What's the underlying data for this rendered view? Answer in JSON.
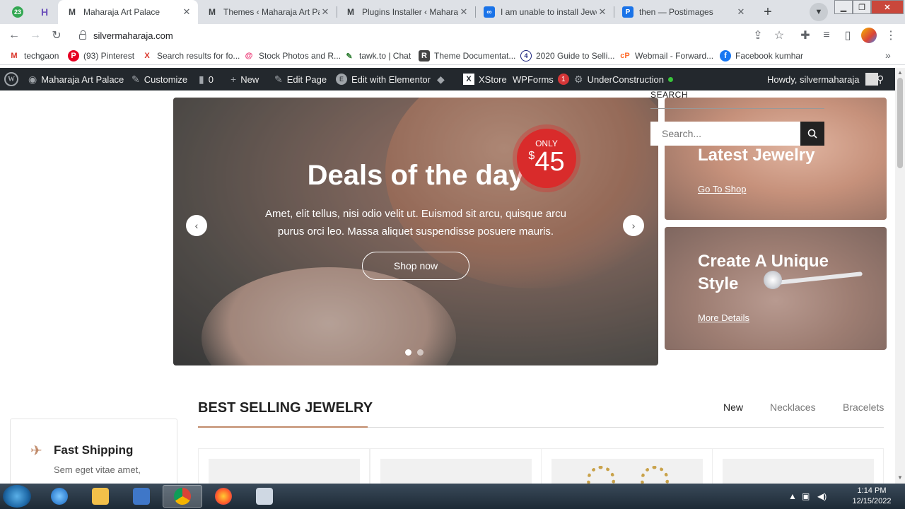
{
  "browser": {
    "pinned": [
      {
        "badge": "23",
        "icon": "badge-icon"
      },
      {
        "icon": "h-logo-icon"
      }
    ],
    "tabs": [
      {
        "title": "Maharaja Art Palace",
        "icon": "m-logo-icon",
        "active": true
      },
      {
        "title": "Themes ‹ Maharaja Art Pala",
        "icon": "m-logo-icon"
      },
      {
        "title": "Plugins Installer ‹ Maharaja",
        "icon": "m-logo-icon"
      },
      {
        "title": "I am unable to install Jewel",
        "icon": "infinity-icon"
      },
      {
        "title": "then — Postimages",
        "icon": "postimages-icon"
      }
    ],
    "url": "silvermaharaja.com",
    "bookmarks": [
      {
        "label": "techgaon",
        "icon": "gmail-icon"
      },
      {
        "label": "(93) Pinterest",
        "icon": "pinterest-icon"
      },
      {
        "label": "Search results for fo...",
        "icon": "x-icon"
      },
      {
        "label": "Stock Photos and R...",
        "icon": "spiral-icon"
      },
      {
        "label": "tawk.to | Chat",
        "icon": "tawk-icon"
      },
      {
        "label": "Theme Documentat...",
        "icon": "doc-icon"
      },
      {
        "label": "2020 Guide to Selli...",
        "icon": "four-icon"
      },
      {
        "label": "Webmail - Forward...",
        "icon": "cpanel-icon"
      },
      {
        "label": "Facebook kumhar",
        "icon": "facebook-icon"
      }
    ]
  },
  "wp_admin": {
    "site_name": "Maharaja Art Palace",
    "customize": "Customize",
    "comments_count": "0",
    "new_label": "New",
    "edit_page": "Edit Page",
    "elementor": "Edit with Elementor",
    "xstore": "XStore",
    "wpforms": "WPForms",
    "wpforms_badge": "1",
    "under_construction": "UnderConstruction",
    "howdy": "Howdy, silvermaharaja"
  },
  "search": {
    "label": "SEARCH",
    "placeholder": "Search..."
  },
  "hero": {
    "title": "Deals of the day",
    "text": "Amet, elit tellus, nisi odio velit ut. Euismod sit arcu, quisque arcu purus orci leo. Massa aliquet suspendisse posuere mauris.",
    "button": "Shop now",
    "price_label": "ONLY",
    "price_currency": "$",
    "price_value": "45",
    "slides": 2,
    "active_slide": 1
  },
  "banners": [
    {
      "title": "Latest Jewelry",
      "link": "Go To Shop"
    },
    {
      "title": "Create A Unique Style",
      "link": "More Details"
    }
  ],
  "best_selling": {
    "title": "BEST SELLING JEWELRY",
    "tabs": [
      "New",
      "Necklaces",
      "Bracelets"
    ],
    "active_tab": "New"
  },
  "feature": {
    "title": "Fast Shipping",
    "text": "Sem eget vitae amet,",
    "icon": "rocket-icon"
  },
  "taskbar": {
    "time": "1:14 PM",
    "date": "12/15/2022"
  }
}
